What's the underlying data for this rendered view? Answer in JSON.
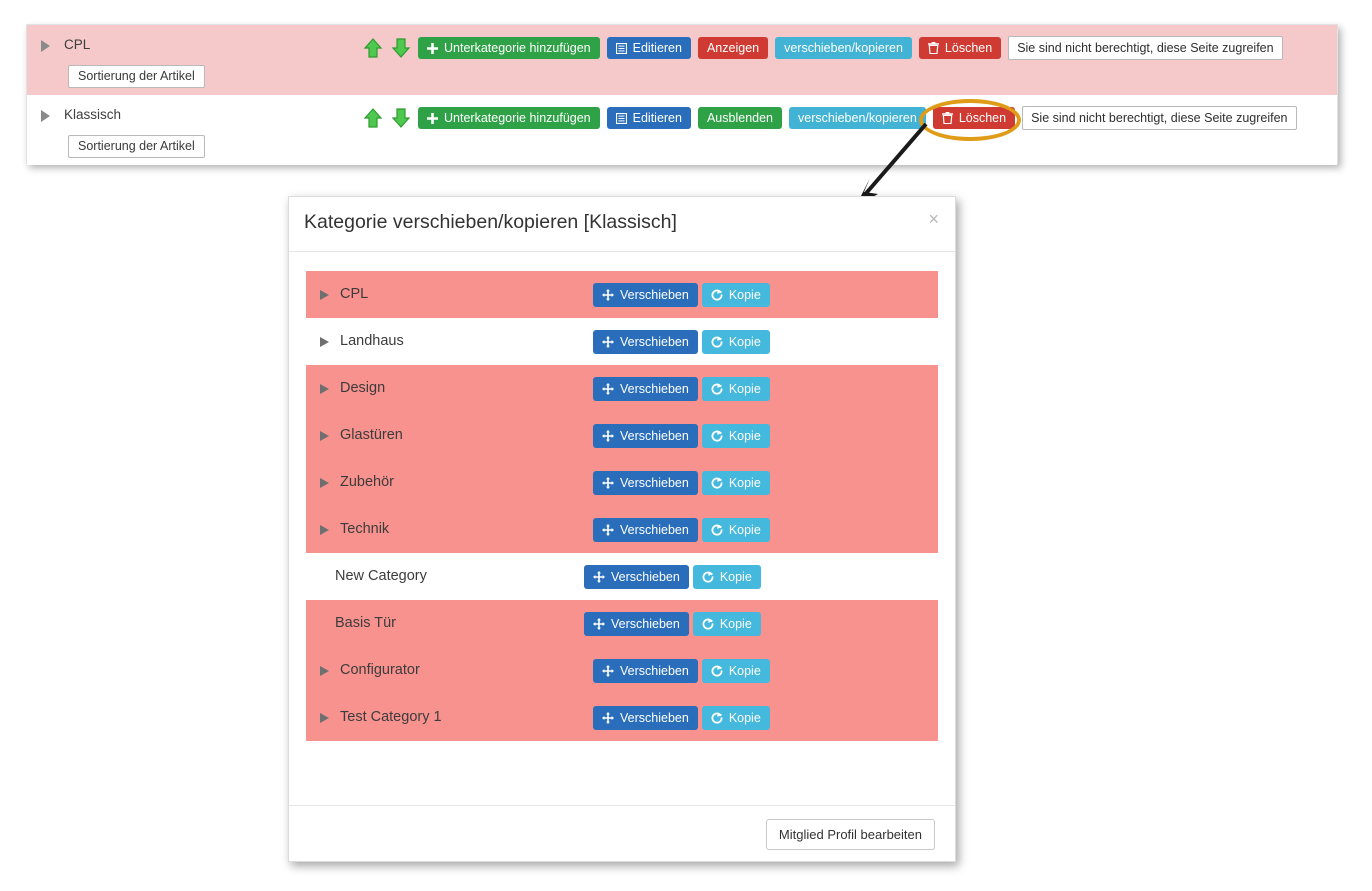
{
  "colors": {
    "accent_green": "#2fa147",
    "accent_blue": "#2a6ebb",
    "accent_red": "#cf3b32",
    "accent_cyan": "#42b3d5",
    "row_pink_light": "#f5c9c9",
    "row_pink_strong": "#f8928e",
    "highlight_orange": "#e09b17"
  },
  "top_panel": {
    "rows": [
      {
        "name": "CPL",
        "highlighted": true,
        "has_children": true,
        "sort_button": "Sortierung der Artikel",
        "move_up_icon": "arrow-up-icon",
        "move_down_icon": "arrow-down-icon",
        "add_sub": "Unterkategorie hinzufügen",
        "edit": "Editieren",
        "visibility": "Anzeigen",
        "visibility_state": "hidden",
        "move_copy": "verschieben/kopieren",
        "delete": "Löschen",
        "permission": "Sie sind nicht berechtigt, diese Seite zugreifen"
      },
      {
        "name": "Klassisch",
        "highlighted": false,
        "has_children": true,
        "sort_button": "Sortierung der Artikel",
        "move_up_icon": "arrow-up-icon",
        "move_down_icon": "arrow-down-icon",
        "add_sub": "Unterkategorie hinzufügen",
        "edit": "Editieren",
        "visibility": "Ausblenden",
        "visibility_state": "visible",
        "move_copy": "verschieben/kopieren",
        "delete": "Löschen",
        "permission": "Sie sind nicht berechtigt, diese Seite zugreifen"
      }
    ]
  },
  "annotation": {
    "target": "Löschen",
    "shape": "ellipse",
    "color": "#e09b17",
    "arrow": "points from the Löschen button down-left to the dialog"
  },
  "modal": {
    "title": "Kategorie verschieben/kopieren  [Klassisch]",
    "close_icon": "close-icon",
    "move_label": "Verschieben",
    "copy_label": "Kopie",
    "move_icon": "move-arrows-icon",
    "copy_icon": "copy-share-icon",
    "footer_button": "Mitglied Profil bearbeiten",
    "items": [
      {
        "label": "CPL",
        "highlighted": true,
        "has_children": true
      },
      {
        "label": "Landhaus",
        "highlighted": false,
        "has_children": true
      },
      {
        "label": "Design",
        "highlighted": true,
        "has_children": true
      },
      {
        "label": "Glastüren",
        "highlighted": true,
        "has_children": true
      },
      {
        "label": "Zubehör",
        "highlighted": true,
        "has_children": true
      },
      {
        "label": "Technik",
        "highlighted": true,
        "has_children": true
      },
      {
        "label": "New Category",
        "highlighted": false,
        "has_children": false
      },
      {
        "label": "Basis Tür",
        "highlighted": true,
        "has_children": false
      },
      {
        "label": "Configurator",
        "highlighted": true,
        "has_children": true
      },
      {
        "label": "Test Category 1",
        "highlighted": true,
        "has_children": true
      }
    ]
  }
}
